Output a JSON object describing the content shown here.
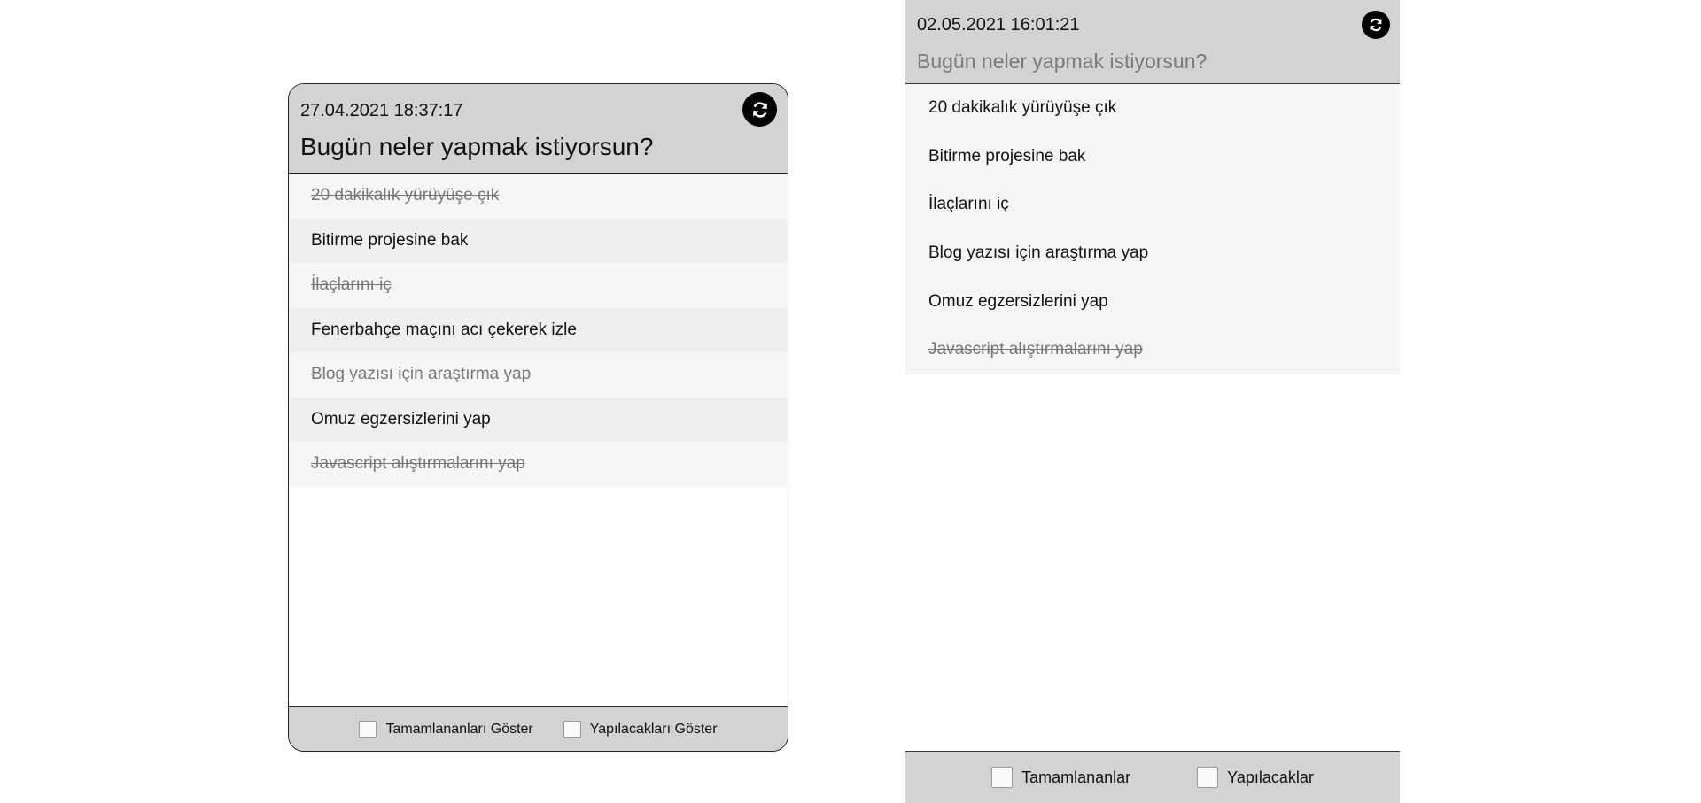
{
  "left_card": {
    "timestamp": "27.04.2021 18:37:17",
    "title": "Bugün neler yapmak istiyorsun?",
    "refresh_icon": "refresh-icon",
    "items": [
      {
        "label": "20 dakikalık yürüyüşe çık",
        "done": true
      },
      {
        "label": "Bitirme projesine bak",
        "done": false
      },
      {
        "label": "İlaçlarını iç",
        "done": true
      },
      {
        "label": "Fenerbahçe maçını acı çekerek izle",
        "done": false
      },
      {
        "label": "Blog yazısı için araştırma yap",
        "done": true
      },
      {
        "label": "Omuz egzersizlerini yap",
        "done": false
      },
      {
        "label": "Javascript alıştırmalarını yap",
        "done": true
      }
    ],
    "filters": {
      "completed_label": "Tamamlananları Göster",
      "completed_checked": false,
      "todo_label": "Yapılacakları Göster",
      "todo_checked": false
    }
  },
  "right_panel": {
    "timestamp": "02.05.2021 16:01:21",
    "input_placeholder": "Bugün neler yapmak istiyorsun?",
    "refresh_icon": "refresh-icon",
    "items": [
      {
        "label": "20 dakikalık yürüyüşe çık",
        "done": false
      },
      {
        "label": "Bitirme projesine bak",
        "done": false
      },
      {
        "label": "İlaçlarını iç",
        "done": false
      },
      {
        "label": "Blog yazısı için araştırma yap",
        "done": false
      },
      {
        "label": "Omuz egzersizlerini yap",
        "done": false
      },
      {
        "label": "Javascript alıştırmalarını yap",
        "done": true
      }
    ],
    "filters": {
      "completed_label": "Tamamlananlar",
      "completed_checked": false,
      "todo_label": "Yapılacaklar",
      "todo_checked": false
    }
  }
}
